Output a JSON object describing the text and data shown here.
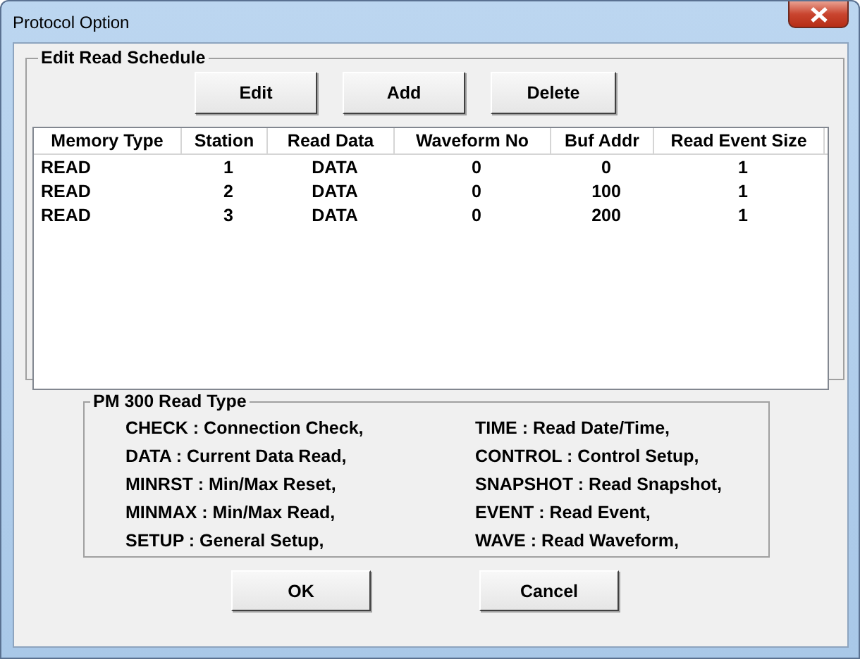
{
  "window": {
    "title": "Protocol Option"
  },
  "schedule": {
    "title": "Edit Read Schedule",
    "buttons": [
      "Edit",
      "Add",
      "Delete"
    ],
    "columns": [
      "Memory Type",
      "Station",
      "Read Data",
      "Waveform No",
      "Buf Addr",
      "Read Event Size"
    ],
    "rows": [
      [
        "READ",
        "1",
        "DATA",
        "0",
        "0",
        "1"
      ],
      [
        "READ",
        "2",
        "DATA",
        "0",
        "100",
        "1"
      ],
      [
        "READ",
        "3",
        "DATA",
        "0",
        "200",
        "1"
      ]
    ]
  },
  "read_types": {
    "title": "PM 300 Read Type",
    "columns": [
      [
        "CHECK : Connection Check,",
        "DATA : Current Data Read,",
        "MINRST : Min/Max Reset,",
        "MINMAX : Min/Max Read,",
        "SETUP : General Setup,"
      ],
      [
        "TIME : Read Date/Time,",
        "CONTROL : Control Setup,",
        "SNAPSHOT : Read Snapshot,",
        "EVENT : Read Event,",
        "WAVE : Read Waveform,"
      ]
    ]
  },
  "buttons": [
    "OK",
    "Cancel"
  ]
}
